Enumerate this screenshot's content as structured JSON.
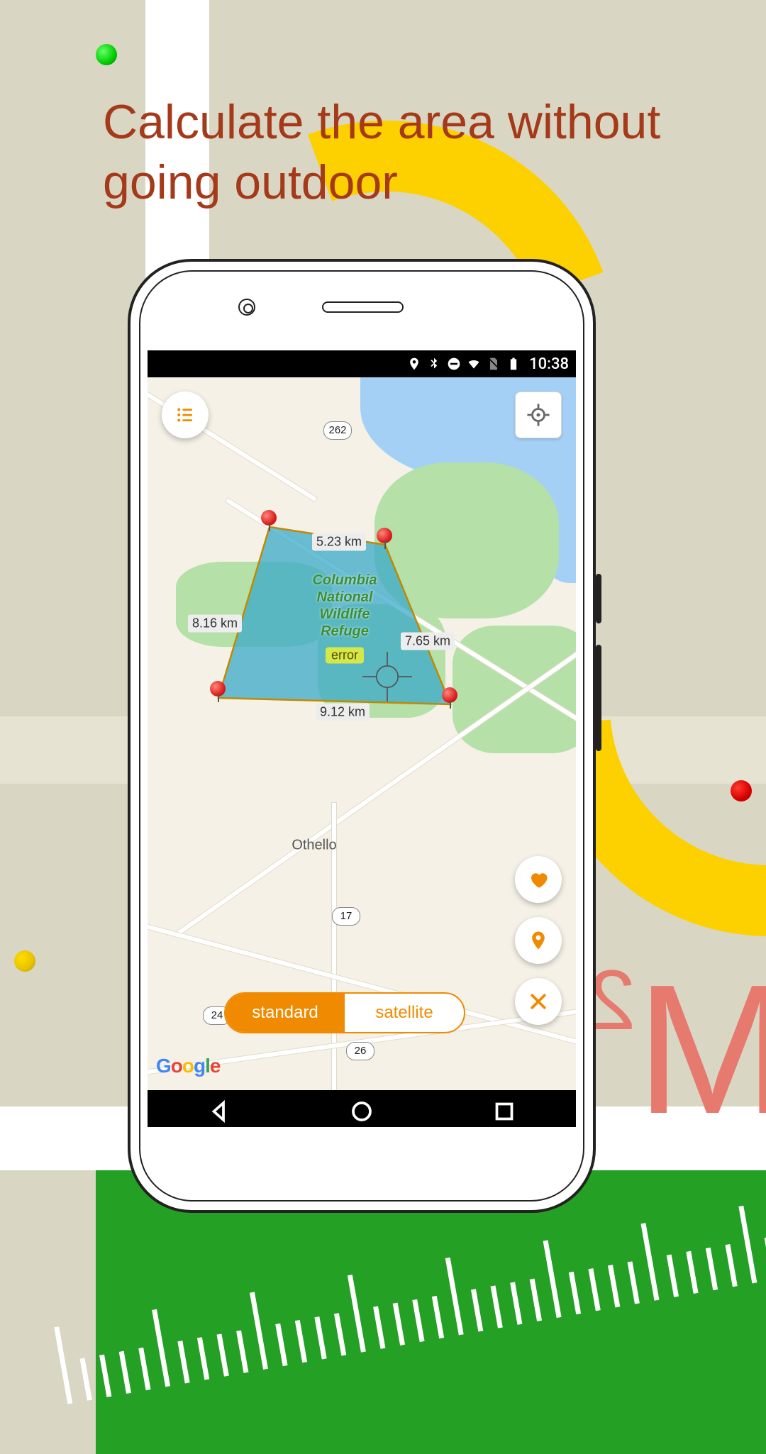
{
  "headline": "Calculate the area without going outdoor",
  "status": {
    "time": "10:38"
  },
  "map": {
    "refuge_name": "Columbia\nNational\nWildlife\nRefuge",
    "error_text": "error",
    "city": "Othello",
    "shields": [
      "262",
      "17",
      "24",
      "26"
    ],
    "edges": {
      "top": "5.23 km",
      "right": "7.65 km",
      "bottom": "9.12 km",
      "left": "8.16 km"
    },
    "attribution": "Google"
  },
  "toggle": {
    "standard": "standard",
    "satellite": "satellite"
  },
  "icons": {
    "menu": "list-icon",
    "locate": "crosshair-icon",
    "favorite": "heart-icon",
    "marker": "pin-icon",
    "close": "close-icon"
  }
}
